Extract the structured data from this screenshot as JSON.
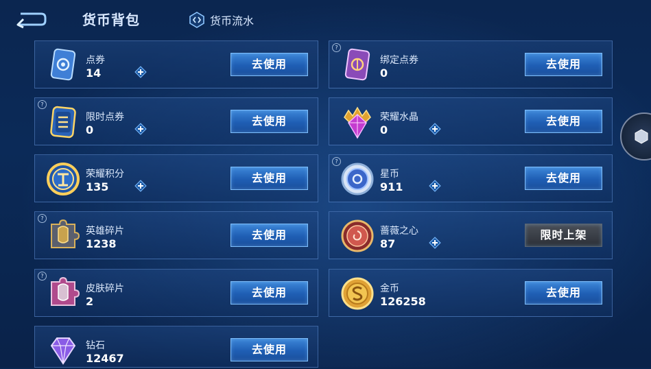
{
  "header": {
    "title": "货币背包",
    "flow_label": "货币流水",
    "back_icon": "back-arrow-icon",
    "flow_icon": "currency-flow-icon"
  },
  "colors": {
    "background": "#0b2650",
    "button_blue": "#2a6fc6",
    "button_gray": "#3a3f48",
    "text": "#e8f1ff"
  },
  "items": [
    {
      "name": "点券",
      "value": "14",
      "button": "去使用",
      "plus": true,
      "help": false,
      "icon": "coupon-card-icon"
    },
    {
      "name": "绑定点券",
      "value": "0",
      "button": "去使用",
      "plus": false,
      "help": true,
      "icon": "bound-coupon-card-icon"
    },
    {
      "name": "限时点券",
      "value": "0",
      "button": "去使用",
      "plus": true,
      "help": true,
      "icon": "limited-coupon-icon"
    },
    {
      "name": "荣耀水晶",
      "value": "0",
      "button": "去使用",
      "plus": true,
      "help": false,
      "icon": "glory-crystal-icon"
    },
    {
      "name": "荣耀积分",
      "value": "135",
      "button": "去使用",
      "plus": true,
      "help": false,
      "icon": "glory-points-icon"
    },
    {
      "name": "星币",
      "value": "911",
      "button": "去使用",
      "plus": true,
      "help": true,
      "icon": "star-coin-icon"
    },
    {
      "name": "英雄碎片",
      "value": "1238",
      "button": "去使用",
      "plus": false,
      "help": true,
      "icon": "hero-fragment-icon"
    },
    {
      "name": "蔷薇之心",
      "value": "87",
      "button": "限时上架",
      "plus": true,
      "help": false,
      "icon": "rose-heart-icon"
    },
    {
      "name": "皮肤碎片",
      "value": "2",
      "button": "去使用",
      "plus": false,
      "help": true,
      "icon": "skin-fragment-icon"
    },
    {
      "name": "金币",
      "value": "126258",
      "button": "去使用",
      "plus": false,
      "help": false,
      "icon": "gold-coin-icon"
    },
    {
      "name": "钻石",
      "value": "12467",
      "button": "去使用",
      "plus": false,
      "help": false,
      "icon": "diamond-icon"
    }
  ],
  "side": {
    "icon": "side-menu-hexagon-icon"
  }
}
